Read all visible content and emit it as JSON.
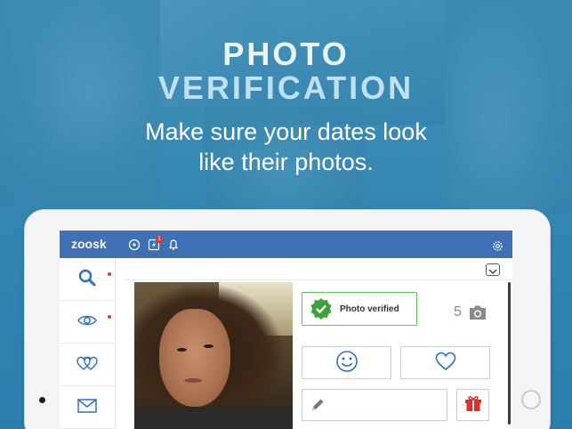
{
  "promo": {
    "headline_line1": "PHOTO",
    "headline_line2": "VERIFICATION",
    "subtitle_line1": "Make sure your dates look",
    "subtitle_line2": "like their photos."
  },
  "app": {
    "logo_text": "zoosk",
    "notification_badge": "1",
    "colors": {
      "topbar": "#3f6fb5",
      "accent_blue": "#2e6fc0",
      "verified_green": "#3aa43b",
      "gift_red": "#d7322b",
      "badge_red": "#e0352b"
    }
  },
  "topbar_icons": [
    "refresh-icon",
    "lightning-icon",
    "bell-icon",
    "gear-icon"
  ],
  "sidebar": {
    "items": [
      {
        "name": "search",
        "icon": "search-icon",
        "has_dot": false
      },
      {
        "name": "views",
        "icon": "eye-icon",
        "has_dot": true
      },
      {
        "name": "matches",
        "icon": "hearts-icon",
        "has_dot": true
      },
      {
        "name": "messages",
        "icon": "envelope-icon",
        "has_dot": false
      }
    ]
  },
  "profile": {
    "verified_label": "Photo verified",
    "photo_count": "5"
  }
}
